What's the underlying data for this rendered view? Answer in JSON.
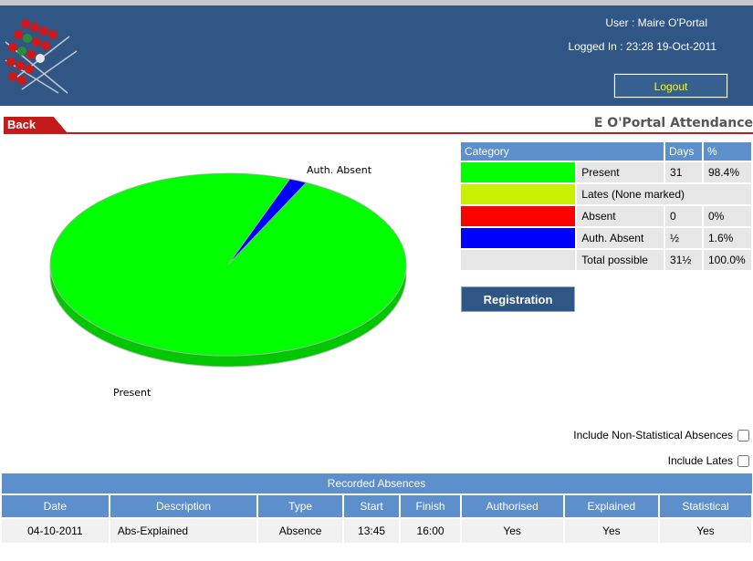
{
  "header": {
    "user_line": "User : Maire O'Portal",
    "logged_in_line": "Logged In : 23:28 19-Oct-2011",
    "logout_label": "Logout"
  },
  "nav": {
    "back_label": "Back",
    "page_title": "E O'Portal Attendance"
  },
  "chart_data": {
    "type": "pie",
    "slices": [
      {
        "label": "Present",
        "value": 98.4,
        "color": "#00ff00"
      },
      {
        "label": "Auth. Absent",
        "value": 1.6,
        "color": "#0000ff"
      }
    ],
    "labels_shown": [
      "Auth. Absent",
      "Present"
    ]
  },
  "summary": {
    "headers": {
      "category": "Category",
      "days": "Days",
      "percent": "%"
    },
    "rows": [
      {
        "label": "Present",
        "days": "31",
        "percent": "98.4%",
        "color": "#00ff00"
      },
      {
        "label": "Lates (None marked)",
        "days": "",
        "percent": "",
        "color": "#c8f000"
      },
      {
        "label": "Absent",
        "days": "0",
        "percent": "0%",
        "color": "#ff0000"
      },
      {
        "label": "Auth. Absent",
        "days": "½",
        "percent": "1.6%",
        "color": "#0000ff"
      },
      {
        "label": "Total possible",
        "days": "31½",
        "percent": "100.0%",
        "color": ""
      }
    ],
    "registration_label": "Registration"
  },
  "options": {
    "non_statistical_label": "Include Non-Statistical Absences",
    "non_statistical_checked": false,
    "lates_label": "Include Lates",
    "lates_checked": false
  },
  "absences": {
    "title": "Recorded Absences",
    "columns": [
      "Date",
      "Description",
      "Type",
      "Start",
      "Finish",
      "Authorised",
      "Explained",
      "Statistical"
    ],
    "rows": [
      [
        "04-10-2011",
        "Abs-Explained",
        "Absence",
        "13:45",
        "16:00",
        "Yes",
        "Yes",
        "Yes"
      ]
    ]
  }
}
